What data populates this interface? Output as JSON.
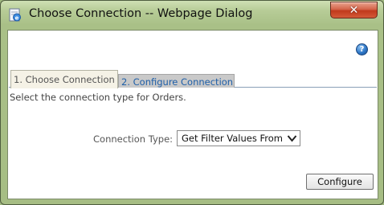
{
  "window": {
    "title": "Choose Connection -- Webpage Dialog",
    "close_glyph": "✕"
  },
  "help": {
    "glyph": "?"
  },
  "tabs": [
    {
      "label": "1. Choose Connection",
      "active": true
    },
    {
      "label": "2. Configure Connection",
      "active": false
    }
  ],
  "description": "Select the connection type for Orders.",
  "connection": {
    "label": "Connection Type:",
    "selected": "Get Filter Values From"
  },
  "buttons": {
    "configure": "Configure"
  },
  "colors": {
    "frame": "#a6bd84",
    "close_button": "#c0391c",
    "inactive_tab": "#c9c9c9",
    "inactive_tab_text": "#1f5fa8",
    "help_icon": "#2f78c8"
  }
}
